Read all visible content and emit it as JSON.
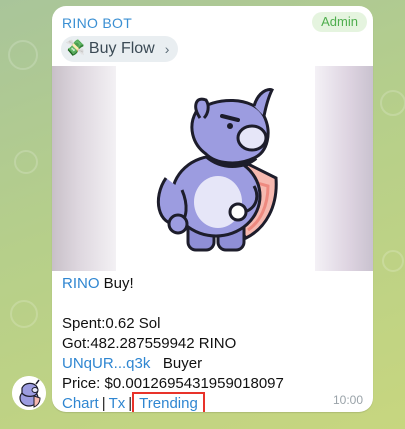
{
  "message": {
    "sender": "RINO BOT",
    "badge": "Admin",
    "reply": {
      "icon": "money-bag-icon",
      "label": "Buy Flow",
      "chevron": "›"
    },
    "title_token": "RINO",
    "title_action": " Buy!",
    "spent": "Spent:0.62 Sol",
    "got": "Got:482.287559942 RINO",
    "wallet": "UNqUR...q3k",
    "wallet_role": "Buyer",
    "price": "Price: $0.0012695431959018097",
    "links": {
      "chart": "Chart",
      "sep1": "|",
      "tx": "Tx",
      "sep2": "|",
      "trending": "Trending"
    },
    "time": "10:00"
  },
  "colors": {
    "link": "#2f86d1",
    "sender": "#3a8fd3",
    "admin_text": "#4fae4e",
    "highlight": "#e8332a"
  }
}
